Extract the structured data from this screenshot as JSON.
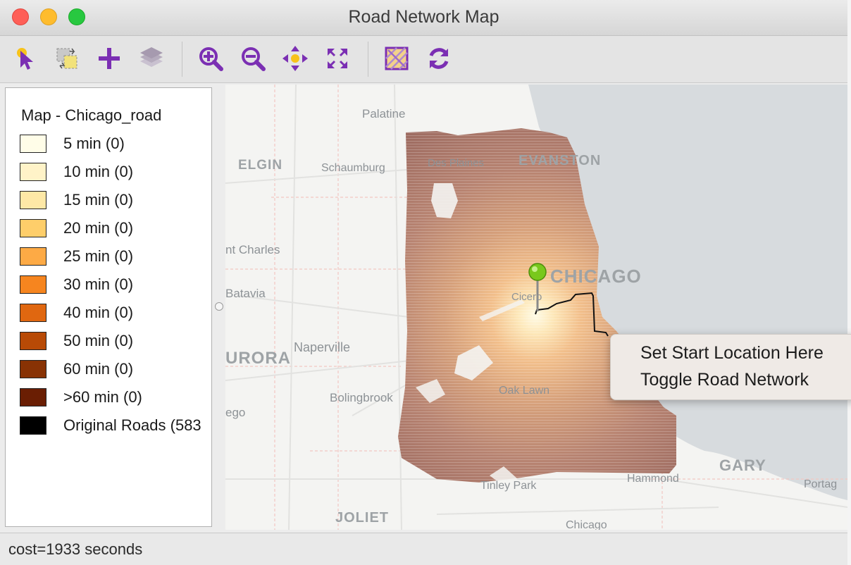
{
  "window": {
    "title": "Road Network Map"
  },
  "toolbar": {
    "tools": [
      {
        "name": "select-tool-button",
        "icon": "pointer-select-icon"
      },
      {
        "name": "selection-shape-button",
        "icon": "selection-shape-icon"
      },
      {
        "name": "add-layer-button",
        "icon": "plus-icon"
      },
      {
        "name": "layers-button",
        "icon": "layers-icon"
      },
      {
        "name": "zoom-in-button",
        "icon": "zoom-in-icon"
      },
      {
        "name": "zoom-out-button",
        "icon": "zoom-out-icon"
      },
      {
        "name": "pan-button",
        "icon": "pan-icon"
      },
      {
        "name": "fit-extent-button",
        "icon": "fit-extent-icon"
      },
      {
        "name": "basemap-button",
        "icon": "basemap-icon"
      },
      {
        "name": "refresh-button",
        "icon": "refresh-icon"
      }
    ],
    "icon_color": "#7b2fb3"
  },
  "legend": {
    "title": "Map - Chicago_road",
    "items": [
      {
        "label": "5 min (0)",
        "color": "#fffde8"
      },
      {
        "label": "10 min (0)",
        "color": "#fff3c8"
      },
      {
        "label": "15 min (0)",
        "color": "#fee8a6"
      },
      {
        "label": "20 min (0)",
        "color": "#fece6a"
      },
      {
        "label": "25 min (0)",
        "color": "#fdaa45"
      },
      {
        "label": "30 min (0)",
        "color": "#f6851f"
      },
      {
        "label": "40 min (0)",
        "color": "#e06710"
      },
      {
        "label": "50 min (0)",
        "color": "#b84a06"
      },
      {
        "label": "60 min (0)",
        "color": "#883204"
      },
      {
        "label": ">60 min (0)",
        "color": "#6a1e03"
      },
      {
        "label": "Original Roads (583",
        "color": "#000000"
      }
    ]
  },
  "map": {
    "labels": {
      "palatine": "Palatine",
      "elgin": "ELGIN",
      "schaumburg": "Schaumburg",
      "des_plaines": "Des Plaines",
      "evanston": "EVANSTON",
      "st_charles": "nt Charles",
      "chicago": "CHICAGO",
      "cicero": "Cicero",
      "batavia": "Batavia",
      "aurora": "URORA",
      "naperville": "Naperville",
      "bolingbrook": "Bolingbrook",
      "oak_lawn": "Oak Lawn",
      "ego": "ego",
      "gary": "GARY",
      "hammond": "Hammond",
      "portage": "Portag",
      "tinley_park": "Tinley Park",
      "joliet": "JOLIET",
      "chicago_heights": "Chicago"
    },
    "colors": {
      "lake": "#d7dbde",
      "land": "#f4f4f2"
    }
  },
  "context_menu": {
    "items": [
      "Set Start Location Here",
      "Toggle Road Network"
    ]
  },
  "status": {
    "text": "cost=1933 seconds"
  }
}
